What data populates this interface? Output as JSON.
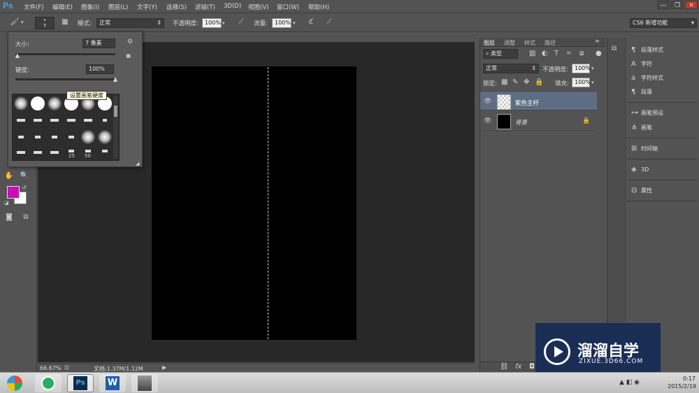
{
  "app": {
    "logo": "Ps"
  },
  "menu": [
    "文件(F)",
    "编辑(E)",
    "图像(I)",
    "图层(L)",
    "文字(Y)",
    "选择(S)",
    "滤镜(T)",
    "3D(D)",
    "视图(V)",
    "窗口(W)",
    "帮助(H)"
  ],
  "window_controls": {
    "minimize": "—",
    "restore": "❐",
    "close": "✕"
  },
  "options": {
    "brush_size": "7",
    "mode_label": "模式:",
    "mode_value": "正常",
    "opacity_label": "不透明度:",
    "opacity_value": "100%",
    "flow_label": "流量:",
    "flow_value": "100%",
    "workspace": "CS6 新增功能"
  },
  "brush_panel": {
    "size_label": "大小:",
    "size_value": "7 像素",
    "hardness_label": "硬度:",
    "hardness_value": "100%",
    "tooltip": "设置画笔硬度",
    "size_level": 0.02,
    "hardness_level": 1.0,
    "preset_numbers": [
      "25",
      "50"
    ]
  },
  "colors": {
    "foreground": "#c80fb4",
    "background": "#ffffff",
    "selected_layer": "#5f6d84",
    "watermark_bg": "#1a2d55"
  },
  "status": {
    "zoom": "66.67%",
    "doc_info": "文档:1.37M/1.12M"
  },
  "layers_panel": {
    "tabs": [
      "图层",
      "调整",
      "样式",
      "路径"
    ],
    "filter_label": "类型",
    "blend_mode": "正常",
    "opacity_label": "不透明度:",
    "opacity_value": "100%",
    "lock_label": "锁定:",
    "fill_label": "填充:",
    "fill_value": "100%",
    "layers": [
      {
        "name": "紫色主杆",
        "selected": true
      },
      {
        "name": "背景",
        "locked": true
      }
    ]
  },
  "dock": {
    "items": [
      "段落样式",
      "字符",
      "字符样式",
      "段落",
      "画笔预设",
      "画笔",
      "时间轴",
      "3D",
      "属性"
    ]
  },
  "taskbar": {
    "time": "0:17",
    "date": "2015/2/19"
  },
  "watermark": {
    "brand": "溜溜自学",
    "url": "ZIXUE.3D66.COM"
  }
}
